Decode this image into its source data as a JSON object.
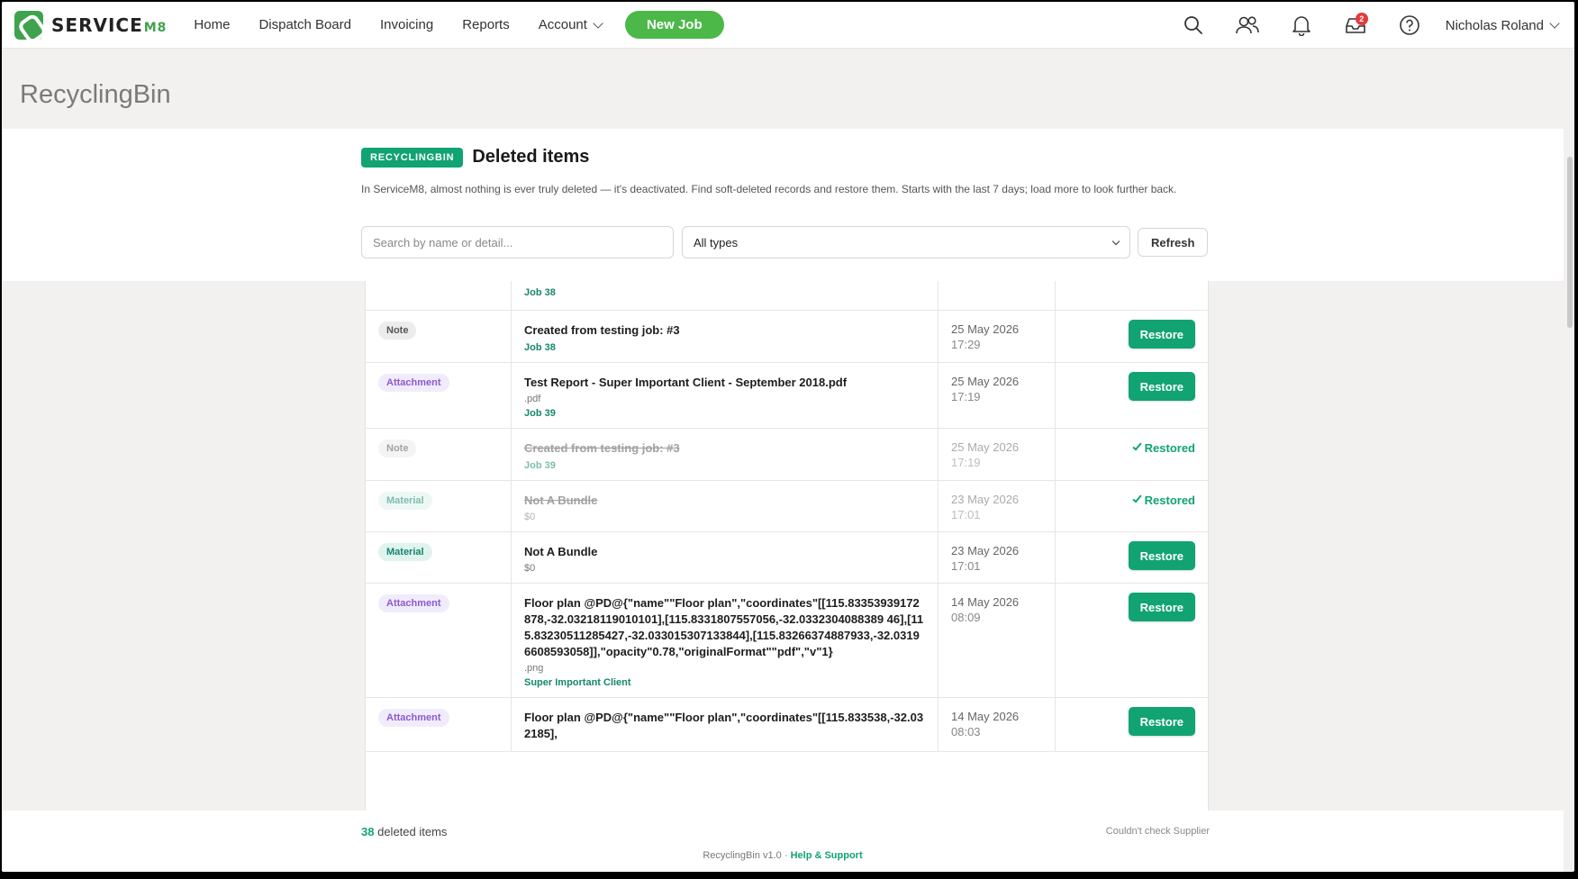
{
  "nav": {
    "brand": "SERVICE",
    "brand_suffix": "M8",
    "items": [
      "Home",
      "Dispatch Board",
      "Invoicing",
      "Reports"
    ],
    "account_label": "Account",
    "new_job_label": "New Job",
    "inbox_badge": "2",
    "user_name": "Nicholas Roland"
  },
  "page": {
    "title": "RecyclingBin"
  },
  "panel": {
    "tag": "RECYCLINGBIN",
    "heading": "Deleted items",
    "description": "In ServiceM8, almost nothing is ever truly deleted — it's deactivated. Find soft-deleted records and restore them. Starts with the last 7 days; load more to look further back.",
    "search_placeholder": "Search by name or detail...",
    "type_filter": "All types",
    "refresh_label": "Refresh"
  },
  "table": {
    "partial_row_link": "Job 38",
    "rows": [
      {
        "type": "Note",
        "kind": "note",
        "title": "Created from testing job: #3",
        "sub": "",
        "link": "Job 38",
        "date": "25 May 2026",
        "time": "17:29",
        "status": "restore"
      },
      {
        "type": "Attachment",
        "kind": "attachment",
        "title": "Test Report - Super Important Client - September 2018.pdf",
        "sub": ".pdf",
        "link": "Job 39",
        "date": "25 May 2026",
        "time": "17:19",
        "status": "restore"
      },
      {
        "type": "Note",
        "kind": "note",
        "title": "Created from testing job: #3",
        "sub": "",
        "link": "Job 39",
        "date": "25 May 2026",
        "time": "17:19",
        "status": "restored"
      },
      {
        "type": "Material",
        "kind": "material",
        "title": "Not A Bundle",
        "sub": "$0",
        "link": "",
        "date": "23 May 2026",
        "time": "17:01",
        "status": "restored"
      },
      {
        "type": "Material",
        "kind": "material",
        "title": "Not A Bundle",
        "sub": "$0",
        "link": "",
        "date": "23 May 2026",
        "time": "17:01",
        "status": "restore"
      },
      {
        "type": "Attachment",
        "kind": "attachment",
        "title": "Floor plan @PD@{\"name\"\"Floor plan\",\"coordinates\"[[115.83353939172878,-32.03218119010101],[115.8331807557056,-32.0332304088389 46],[115.83230511285427,-32.033015307133844],[115.83266374887933,-32.03196608593058]],\"opacity\"0.78,\"originalFormat\"\"pdf\",\"v\"1}",
        "sub": ".png",
        "link": "Super Important Client",
        "date": "14 May 2026",
        "time": "08:09",
        "status": "restore"
      },
      {
        "type": "Attachment",
        "kind": "attachment",
        "title": "Floor plan @PD@{\"name\"\"Floor plan\",\"coordinates\"[[115.833538,-32.032185],",
        "sub": "",
        "link": "",
        "date": "14 May 2026",
        "time": "08:03",
        "status": "restore"
      }
    ],
    "restore_label": "Restore",
    "restored_label": "Restored"
  },
  "footer": {
    "count": "38",
    "count_label": "deleted items",
    "warning": "Couldn't check Supplier",
    "version": "RecyclingBin v1.0 ·",
    "help": "Help & Support"
  },
  "colors": {
    "brand_green": "#4cb848",
    "accent": "#11a372",
    "badge_red": "#e23b3b"
  },
  "icons": [
    "search-icon",
    "people-icon",
    "bell-icon",
    "inbox-icon",
    "help-icon",
    "chevron-down-icon",
    "checkmark-icon"
  ]
}
